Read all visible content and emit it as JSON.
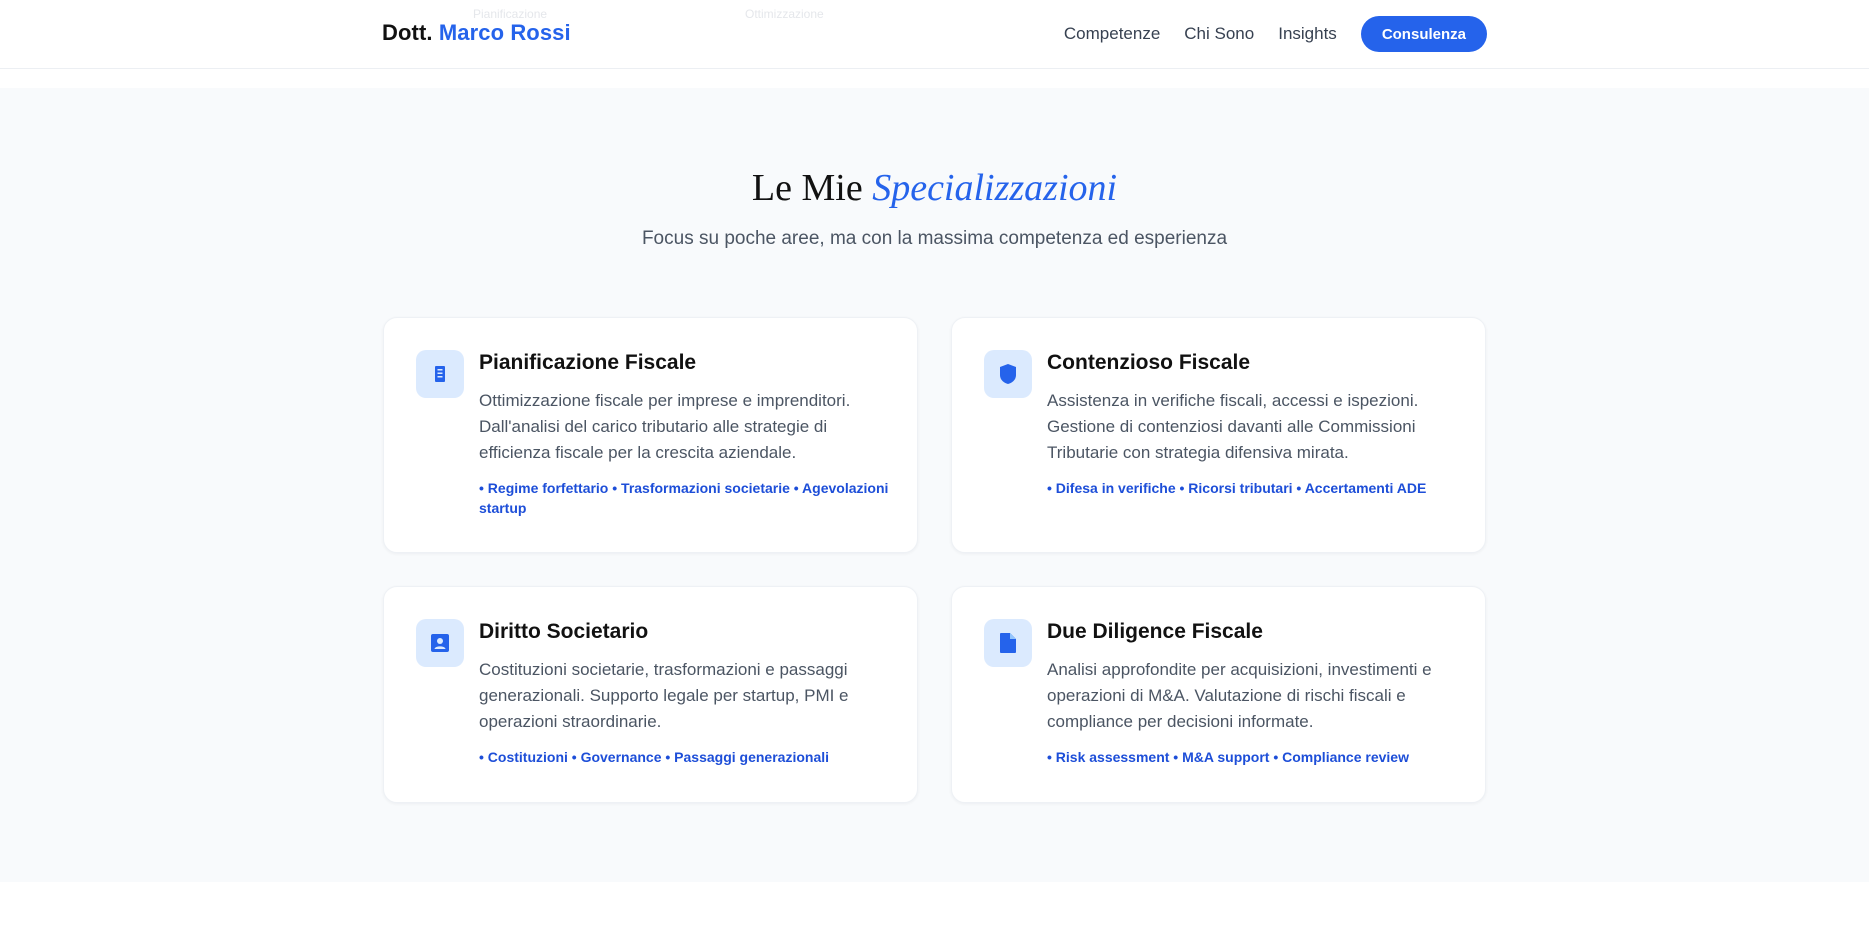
{
  "header": {
    "brand_prefix": "Dott.",
    "brand_name": "Marco Rossi",
    "nav": [
      "Competenze",
      "Chi Sono",
      "Insights"
    ],
    "cta_label": "Consulenza",
    "faded_texts": [
      "Pianificazione",
      "Ottimizzazione"
    ]
  },
  "section": {
    "title_plain": "Le Mie",
    "title_accent": "Specializzazioni",
    "subtitle": "Focus su poche aree, ma con la massima competenza ed esperienza"
  },
  "cards": [
    {
      "icon": "building-icon",
      "title": "Pianificazione Fiscale",
      "desc": "Ottimizzazione fiscale per imprese e imprenditori. Dall'analisi del carico tributario alle strategie di efficienza fiscale per la crescita aziendale.",
      "tags": "• Regime forfettario • Trasformazioni societarie • Agevolazioni startup"
    },
    {
      "icon": "shield-icon",
      "title": "Contenzioso Fiscale",
      "desc": "Assistenza in verifiche fiscali, accessi e ispezioni. Gestione di contenziosi davanti alle Commissioni Tributarie con strategia difensiva mirata.",
      "tags": "• Difesa in verifiche • Ricorsi tributari • Accertamenti ADE"
    },
    {
      "icon": "user-badge-icon",
      "title": "Diritto Societario",
      "desc": "Costituzioni societarie, trasformazioni e passaggi generazionali. Supporto legale per startup, PMI e operazioni straordinarie.",
      "tags": "• Costituzioni • Governance • Passaggi generazionali"
    },
    {
      "icon": "document-icon",
      "title": "Due Diligence Fiscale",
      "desc": "Analisi approfondite per acquisizioni, investimenti e operazioni di M&A. Valutazione di rischi fiscali e compliance per decisioni informate.",
      "tags": "• Risk assessment • M&A support • Compliance review"
    }
  ],
  "colors": {
    "accent": "#2563eb",
    "tag": "#1d4ed8",
    "icon_bg": "#dbeafe",
    "section_bg": "#f8fafc"
  }
}
